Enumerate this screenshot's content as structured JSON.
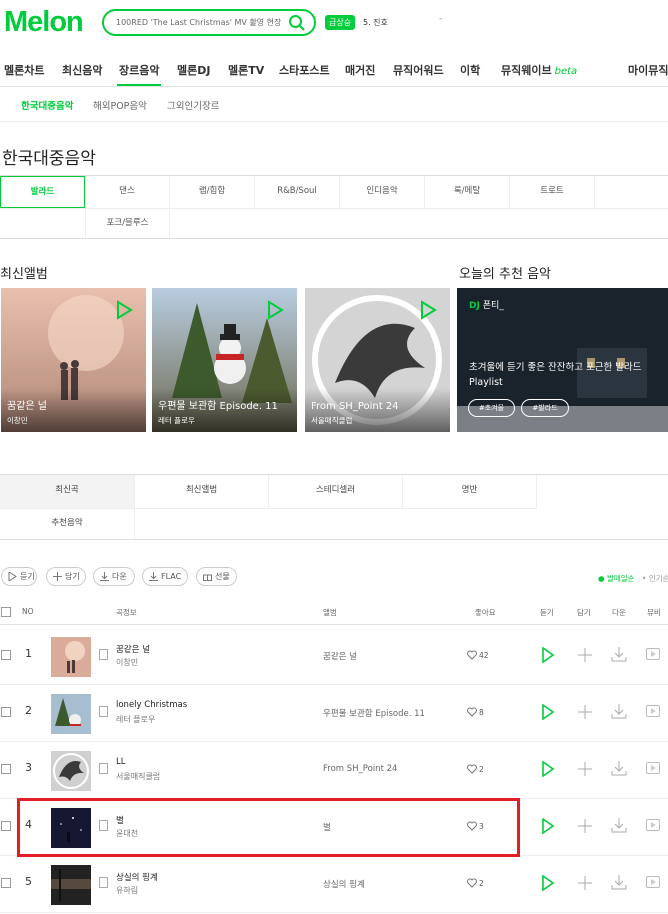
{
  "header": {
    "logo": "Melon",
    "search_placeholder": "100RED 'The Last Christmas' MV 촬영 현장",
    "live_badge": "급상승",
    "rank_text": "5. 진호",
    "rank_dash": "-"
  },
  "gnb": [
    {
      "label": "멜론차트"
    },
    {
      "label": "최신음악"
    },
    {
      "label": "장르음악"
    },
    {
      "label": "멜론DJ"
    },
    {
      "label": "멜론TV"
    },
    {
      "label": "스타포스트"
    },
    {
      "label": "매거진"
    },
    {
      "label": "뮤직어워드"
    },
    {
      "label": "이학"
    },
    {
      "label": "뮤직웨이브",
      "badge": "beta"
    },
    {
      "label": "마이뮤직"
    }
  ],
  "subnav": [
    "한국대중음악",
    "해외POP음악",
    "그외인기장르"
  ],
  "page_title": "한국대중음악",
  "genres": [
    "발라드",
    "댄스",
    "랩/힙합",
    "R&B/Soul",
    "인디음악",
    "록/메탈",
    "트로트",
    "포크/블루스"
  ],
  "sections": {
    "new_albums": "최신앨범",
    "recommend": "오늘의 추천 음악"
  },
  "albums": [
    {
      "title": "꿈같은 널",
      "artist": "이창민"
    },
    {
      "title": "우편물 보관함 Episode. 11",
      "artist": "레터 플로우"
    },
    {
      "title": "From SH_Point 24",
      "artist": "서울매직클럽"
    }
  ],
  "recommend": {
    "dj_label": "DJ",
    "dj_name": "폰티_",
    "description": "초겨울에 듣기 좋은 잔잔하고 포근한 발라드 Playlist",
    "tags": [
      "#초겨울",
      "#발라드"
    ]
  },
  "tabs": [
    "최신곡",
    "최신앨범",
    "스테디셀러",
    "명반",
    "추천음악"
  ],
  "buttons": [
    "듣기",
    "담기",
    "다운",
    "FLAC",
    "선물"
  ],
  "sort": {
    "active": "발매일순",
    "other": "인기순"
  },
  "table_headers": {
    "no": "NO",
    "song": "곡정보",
    "album": "앨범",
    "likes": "좋아요",
    "play": "듣기",
    "add": "담기",
    "download": "다운",
    "mv": "뮤비"
  },
  "songs": [
    {
      "no": "1",
      "title": "꿈같은 널",
      "artist": "이창민",
      "album": "꿈같은 널",
      "likes": "42"
    },
    {
      "no": "2",
      "title": "lonely Christmas",
      "artist": "레터 플로우",
      "album": "우편물 보관함 Episode. 11",
      "likes": "8"
    },
    {
      "no": "3",
      "title": "LL",
      "artist": "서울매직클럽",
      "album": "From SH_Point 24",
      "likes": "2"
    },
    {
      "no": "4",
      "title": "별",
      "artist": "윤대천",
      "album": "별",
      "likes": "3"
    },
    {
      "no": "5",
      "title": "상실의 핑계",
      "artist": "유하림",
      "album": "상실의 핑계",
      "likes": "2"
    }
  ],
  "colors": {
    "brand": "#00cd3c",
    "highlight": "#e31e24"
  }
}
